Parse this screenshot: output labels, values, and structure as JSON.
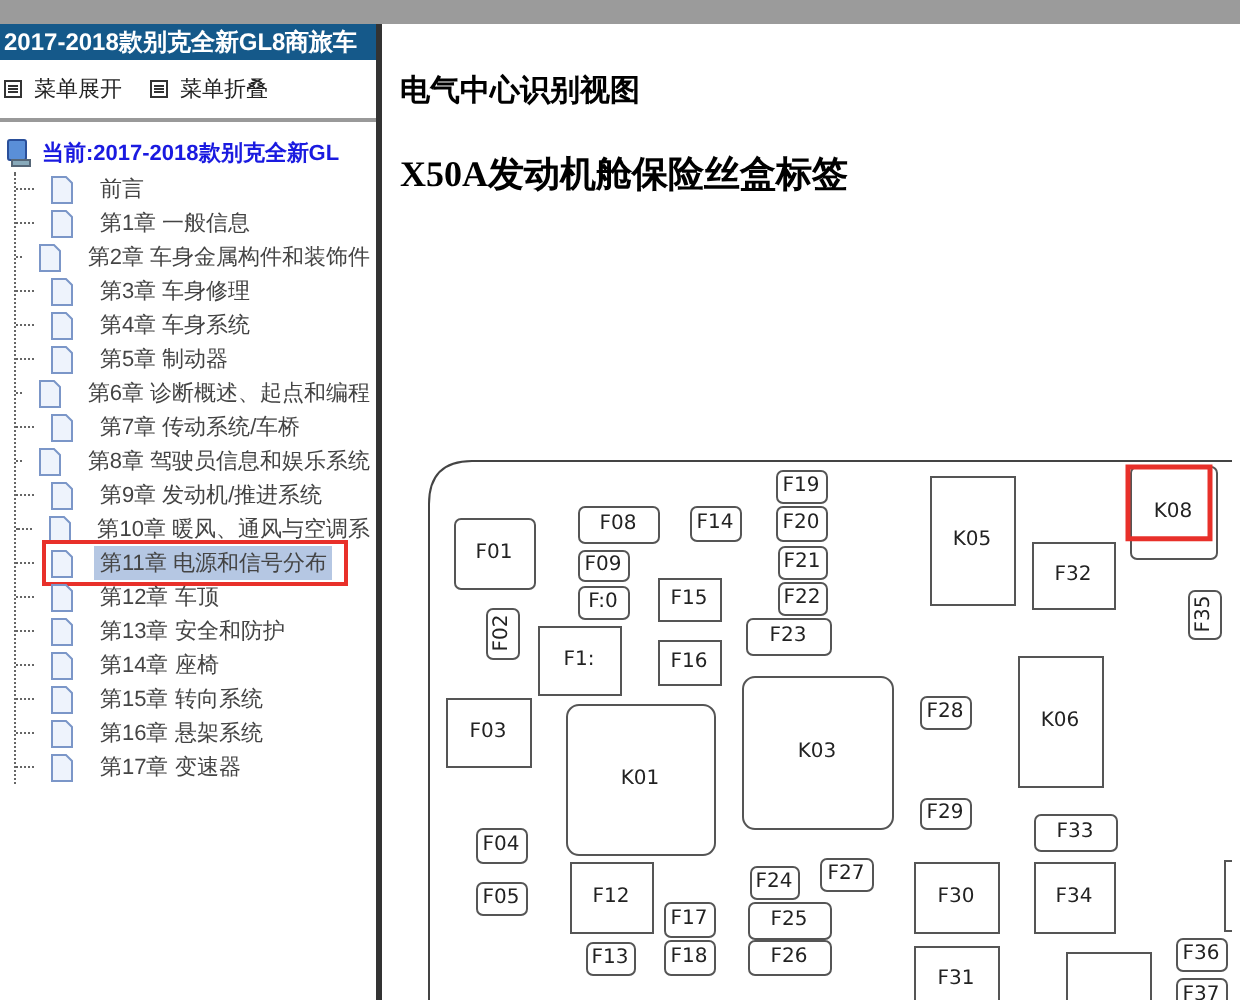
{
  "sidebar": {
    "title": "2017-2018款别克全新GL8商旅车",
    "menu_buttons": [
      "菜单展开",
      "菜单折叠"
    ],
    "tree": {
      "label": "当前:2017-2018款别克全新GL",
      "children": [
        {
          "label": "前言",
          "selected": false,
          "annotated": false
        },
        {
          "label": "第1章 一般信息",
          "selected": false,
          "annotated": false
        },
        {
          "label": "第2章 车身金属构件和装饰件",
          "selected": false,
          "annotated": false
        },
        {
          "label": "第3章 车身修理",
          "selected": false,
          "annotated": false
        },
        {
          "label": "第4章 车身系统",
          "selected": false,
          "annotated": false
        },
        {
          "label": "第5章 制动器",
          "selected": false,
          "annotated": false
        },
        {
          "label": "第6章 诊断概述、起点和编程",
          "selected": false,
          "annotated": false
        },
        {
          "label": "第7章 传动系统/车桥",
          "selected": false,
          "annotated": false
        },
        {
          "label": "第8章 驾驶员信息和娱乐系统",
          "selected": false,
          "annotated": false
        },
        {
          "label": "第9章 发动机/推进系统",
          "selected": false,
          "annotated": false
        },
        {
          "label": "第10章 暖风、通风与空调系",
          "selected": false,
          "annotated": false
        },
        {
          "label": "第11章 电源和信号分布",
          "selected": true,
          "annotated": true
        },
        {
          "label": "第12章 车顶",
          "selected": false,
          "annotated": false
        },
        {
          "label": "第13章 安全和防护",
          "selected": false,
          "annotated": false
        },
        {
          "label": "第14章 座椅",
          "selected": false,
          "annotated": false
        },
        {
          "label": "第15章 转向系统",
          "selected": false,
          "annotated": false
        },
        {
          "label": "第16章 悬架系统",
          "selected": false,
          "annotated": false
        },
        {
          "label": "第17章 变速器",
          "selected": false,
          "annotated": false
        }
      ]
    }
  },
  "content": {
    "heading": "电气中心识别视图",
    "subheading": "X50A发动机舱保险丝盒标签",
    "fuse_box": {
      "slots": [
        {
          "label": "F01",
          "annotated": false
        },
        {
          "label": "F08",
          "annotated": false
        },
        {
          "label": "F14",
          "annotated": false
        },
        {
          "label": "F19",
          "annotated": false
        },
        {
          "label": "F20",
          "annotated": false
        },
        {
          "label": "F21",
          "annotated": false
        },
        {
          "label": "F22",
          "annotated": false
        },
        {
          "label": "F23",
          "annotated": false
        },
        {
          "label": "K05",
          "annotated": false
        },
        {
          "label": "K08",
          "annotated": true
        },
        {
          "label": "F32",
          "annotated": false
        },
        {
          "label": "F35",
          "annotated": false
        },
        {
          "label": "F09",
          "annotated": false
        },
        {
          "label": "F:0",
          "annotated": false
        },
        {
          "label": "F15",
          "annotated": false
        },
        {
          "label": "F02",
          "annotated": false
        },
        {
          "label": "F1:",
          "annotated": false
        },
        {
          "label": "F16",
          "annotated": false
        },
        {
          "label": "F28",
          "annotated": false
        },
        {
          "label": "K06",
          "annotated": false
        },
        {
          "label": "F03",
          "annotated": false
        },
        {
          "label": "K01",
          "annotated": false
        },
        {
          "label": "K03",
          "annotated": false
        },
        {
          "label": "F29",
          "annotated": false
        },
        {
          "label": "F33",
          "annotated": false
        },
        {
          "label": "F04",
          "annotated": false
        },
        {
          "label": "F05",
          "annotated": false
        },
        {
          "label": "F12",
          "annotated": false
        },
        {
          "label": "F17",
          "annotated": false
        },
        {
          "label": "F13",
          "annotated": false
        },
        {
          "label": "F18",
          "annotated": false
        },
        {
          "label": "F24",
          "annotated": false
        },
        {
          "label": "F27",
          "annotated": false
        },
        {
          "label": "F25",
          "annotated": false
        },
        {
          "label": "F26",
          "annotated": false
        },
        {
          "label": "F30",
          "annotated": false
        },
        {
          "label": "F34",
          "annotated": false
        },
        {
          "label": "F31",
          "annotated": false
        },
        {
          "label": "F36",
          "annotated": false
        },
        {
          "label": "F37",
          "annotated": false
        }
      ]
    }
  }
}
